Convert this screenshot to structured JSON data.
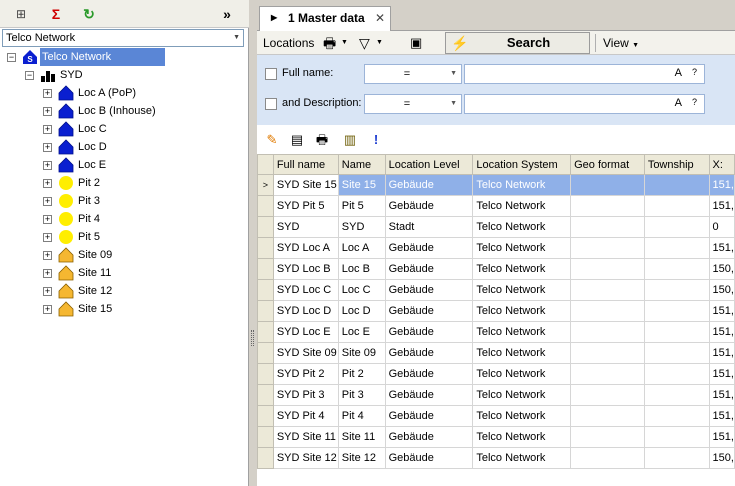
{
  "left_panel": {
    "toolbar": {
      "icons": [
        "tree-add-icon",
        "sigma-icon",
        "refresh-icon"
      ],
      "sigma_glyph": "Σ",
      "refresh_glyph": "↻",
      "add_glyph": "⊞",
      "collapse_glyph": "»"
    },
    "network_dropdown": {
      "value": "Telco Network"
    },
    "tree": {
      "root": {
        "label": "Telco Network"
      },
      "child": {
        "label": "SYD"
      },
      "items": [
        {
          "label": "Loc A (PoP)",
          "icon": "house-blue"
        },
        {
          "label": "Loc B (Inhouse)",
          "icon": "house-blue"
        },
        {
          "label": "Loc C",
          "icon": "house-blue"
        },
        {
          "label": "Loc D",
          "icon": "house-blue"
        },
        {
          "label": "Loc E",
          "icon": "house-blue"
        },
        {
          "label": "Pit 2",
          "icon": "circle-yellow"
        },
        {
          "label": "Pit 3",
          "icon": "circle-yellow"
        },
        {
          "label": "Pit 4",
          "icon": "circle-yellow"
        },
        {
          "label": "Pit 5",
          "icon": "circle-yellow"
        },
        {
          "label": "Site 09",
          "icon": "house-orange"
        },
        {
          "label": "Site 11",
          "icon": "house-orange"
        },
        {
          "label": "Site 12",
          "icon": "house-orange"
        },
        {
          "label": "Site 15",
          "icon": "house-orange"
        }
      ]
    }
  },
  "right_panel": {
    "tab": {
      "label": "1 Master data",
      "close": "✕",
      "arrow": "▶"
    },
    "toolbar": {
      "locations_label": "Locations",
      "search_label": "Search",
      "view_label": "View"
    },
    "filters": [
      {
        "label": "Full name:",
        "operator": "=",
        "value": "",
        "case_glyph": "A",
        "help_glyph": "?"
      },
      {
        "label": "and Description:",
        "operator": "=",
        "value": "",
        "case_glyph": "A",
        "help_glyph": "?"
      }
    ],
    "grid": {
      "columns": [
        "Full name",
        "Name",
        "Location Level",
        "Location System",
        "Geo format",
        "Township",
        "X:"
      ],
      "rows": [
        [
          "SYD Site 15",
          "Site 15",
          "Gebäude",
          "Telco Network",
          "",
          "",
          "151,"
        ],
        [
          "SYD Pit 5",
          "Pit 5",
          "Gebäude",
          "Telco Network",
          "",
          "",
          "151,"
        ],
        [
          "SYD",
          "SYD",
          "Stadt",
          "Telco Network",
          "",
          "",
          "0"
        ],
        [
          "SYD Loc A",
          "Loc A",
          "Gebäude",
          "Telco Network",
          "",
          "",
          "151,"
        ],
        [
          "SYD Loc B",
          "Loc B",
          "Gebäude",
          "Telco Network",
          "",
          "",
          "150,"
        ],
        [
          "SYD Loc C",
          "Loc C",
          "Gebäude",
          "Telco Network",
          "",
          "",
          "150,"
        ],
        [
          "SYD Loc D",
          "Loc D",
          "Gebäude",
          "Telco Network",
          "",
          "",
          "151,"
        ],
        [
          "SYD Loc E",
          "Loc E",
          "Gebäude",
          "Telco Network",
          "",
          "",
          "151,"
        ],
        [
          "SYD Site 09",
          "Site 09",
          "Gebäude",
          "Telco Network",
          "",
          "",
          "151,"
        ],
        [
          "SYD Pit 2",
          "Pit 2",
          "Gebäude",
          "Telco Network",
          "",
          "",
          "151,"
        ],
        [
          "SYD Pit 3",
          "Pit 3",
          "Gebäude",
          "Telco Network",
          "",
          "",
          "151,"
        ],
        [
          "SYD Pit 4",
          "Pit 4",
          "Gebäude",
          "Telco Network",
          "",
          "",
          "151,"
        ],
        [
          "SYD Site 11",
          "Site 11",
          "Gebäude",
          "Telco Network",
          "",
          "",
          "151,"
        ],
        [
          "SYD Site 12",
          "Site 12",
          "Gebäude",
          "Telco Network",
          "",
          "",
          "150,"
        ]
      ],
      "selected_row": 0,
      "row_indicator": ">"
    }
  },
  "colors": {
    "selection": "#8fb0e8",
    "tree_selection": "#5a86d6",
    "house_blue": "#0a1fd0",
    "pit_yellow": "#ffee00",
    "house_orange": "#f5b731",
    "filter_bg": "#d9e5f5"
  }
}
